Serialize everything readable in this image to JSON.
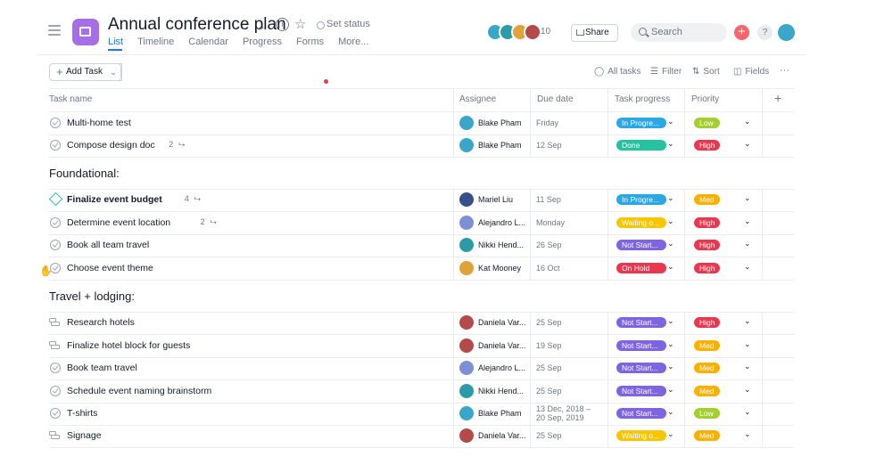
{
  "project": {
    "title": "Annual conference plan",
    "set_status": "Set status",
    "tabs": [
      "List",
      "Timeline",
      "Calendar",
      "Progress",
      "Forms",
      "More..."
    ],
    "member_count": "10",
    "share": "Share",
    "search_placeholder": "Search",
    "accent": "#1f76e5",
    "icon_color": "#a76ee8"
  },
  "toolbar": {
    "add_task": "Add Task",
    "all_tasks": "All tasks",
    "filter": "Filter",
    "sort": "Sort",
    "fields": "Fields",
    "more": "···"
  },
  "columns": {
    "task_name": "Task name",
    "assignee": "Assignee",
    "due_date": "Due date",
    "task_progress": "Task progress",
    "priority": "Priority",
    "add": "+"
  },
  "colors": {
    "In Progre...": "#2ba7e6",
    "Done": "#25c2a0",
    "Waiting o...": "#f8c600",
    "Not Start...": "#7e65e0",
    "On Hold": "#e8384f",
    "Low": "#a4cf30",
    "High": "#e8384f",
    "Med": "#fab000"
  },
  "rows_top": [
    {
      "name": "Multi-home test",
      "icon": "check-icon",
      "subtasks": "",
      "assignee": "Blake Pham",
      "due": "Friday",
      "progress": "In Progre...",
      "priority": "Low",
      "avatar": "#3aa6c9"
    },
    {
      "name": "Compose design doc",
      "icon": "check-icon",
      "subtasks": "2",
      "assignee": "Blake Pham",
      "due": "12 Sep",
      "progress": "Done",
      "priority": "High",
      "avatar": "#3aa6c9"
    }
  ],
  "sections": [
    {
      "title": "Foundational:",
      "rows": [
        {
          "name": "Finalize event budget",
          "icon": "milestone-icon",
          "subtasks": "4",
          "assignee": "Mariel Liu",
          "due": "11 Sep",
          "progress": "In Progre...",
          "priority": "Med",
          "avatar": "#35508a"
        },
        {
          "name": "Determine event location",
          "icon": "check-icon",
          "subtasks": "2",
          "assignee": "Alejandro L...",
          "due": "Monday",
          "progress": "Waiting o...",
          "priority": "High",
          "avatar": "#7d8fd6"
        },
        {
          "name": "Book all team travel",
          "icon": "check-icon",
          "subtasks": "",
          "assignee": "Nikki Hend...",
          "due": "26 Sep",
          "progress": "Not Start...",
          "priority": "High",
          "avatar": "#2e9aa8"
        },
        {
          "name": "Choose event theme",
          "icon": "check-icon",
          "subtasks": "",
          "assignee": "Kat Mooney",
          "due": "16 Oct",
          "progress": "On Hold",
          "priority": "High",
          "avatar": "#e0a33a"
        }
      ]
    },
    {
      "title": "Travel + lodging:",
      "rows": [
        {
          "name": "Research hotels",
          "icon": "approval-icon",
          "subtasks": "",
          "assignee": "Daniela Var...",
          "due": "25 Sep",
          "progress": "Not Start...",
          "priority": "High",
          "avatar": "#b44a4a"
        },
        {
          "name": "Finalize hotel block for guests",
          "icon": "approval-icon",
          "subtasks": "",
          "assignee": "Daniela Var...",
          "due": "19 Sep",
          "progress": "Not Start...",
          "priority": "Med",
          "avatar": "#b44a4a"
        },
        {
          "name": "Book team travel",
          "icon": "check-icon",
          "subtasks": "",
          "assignee": "Alejandro L...",
          "due": "25 Sep",
          "progress": "Not Start...",
          "priority": "Med",
          "avatar": "#7d8fd6"
        },
        {
          "name": "Schedule event naming brainstorm",
          "icon": "check-icon",
          "subtasks": "",
          "assignee": "Nikki Hend...",
          "due": "25 Sep",
          "progress": "Not Start...",
          "priority": "Med",
          "avatar": "#2e9aa8"
        },
        {
          "name": "T-shirts",
          "icon": "check-icon",
          "subtasks": "",
          "assignee": "Blake Pham",
          "due": "13 Dec, 2018 –\n20 Sep, 2019",
          "progress": "Not Start...",
          "priority": "Low",
          "avatar": "#3aa6c9"
        },
        {
          "name": "Signage",
          "icon": "approval-icon",
          "subtasks": "",
          "assignee": "Daniela Var...",
          "due": "25 Sep",
          "progress": "Waiting o...",
          "priority": "Med",
          "avatar": "#b44a4a"
        }
      ]
    }
  ]
}
